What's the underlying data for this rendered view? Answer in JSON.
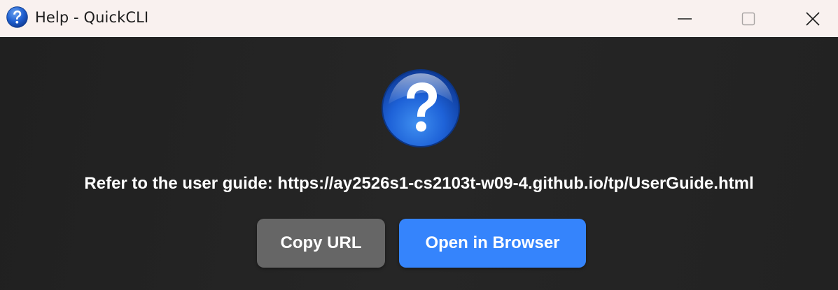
{
  "window": {
    "title": "Help - QuickCLI",
    "icon": "help-icon"
  },
  "controls": {
    "minimize_icon": "minimize-icon",
    "maximize_icon": "maximize-icon",
    "close_icon": "close-icon"
  },
  "content": {
    "icon": "question-mark-icon",
    "message": "Refer to the user guide: https://ay2526s1-cs2103t-w09-4.github.io/tp/UserGuide.html"
  },
  "buttons": {
    "copy_url": "Copy URL",
    "open_browser": "Open in Browser"
  },
  "colors": {
    "titlebar_bg": "#f9f1ef",
    "content_bg": "#232323",
    "copy_button_bg": "#666666",
    "open_button_bg": "#3584fc",
    "text": "#ffffff"
  }
}
